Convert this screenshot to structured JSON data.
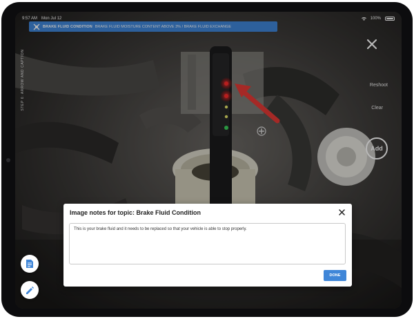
{
  "status_bar": {
    "time": "9:57 AM",
    "date": "Mon Jul 12",
    "battery": "100%"
  },
  "banner": {
    "topic": "BRAKE FLUID CONDITION",
    "message": "BRAKE FLUID MOISTURE CONTENT ABOVE 3% / BRAKE FLUID EXCHANGE"
  },
  "side_label": "STEP 6: ARROW AND CAPTION",
  "controls": {
    "reshoot": "Reshoot",
    "clear": "Clear",
    "add": "Add"
  },
  "modal": {
    "title": "Image notes for topic: Brake Fluid Condition",
    "notes_text": "This is your brake fluid and it needs to be replaced so that your vehicle is able to stop properly.",
    "done_label": "DONE"
  },
  "colors": {
    "accent": "#3f86d8",
    "annotation_arrow": "#e53935",
    "led_red": "#ff2a2a",
    "led_green": "#3bd15a"
  }
}
